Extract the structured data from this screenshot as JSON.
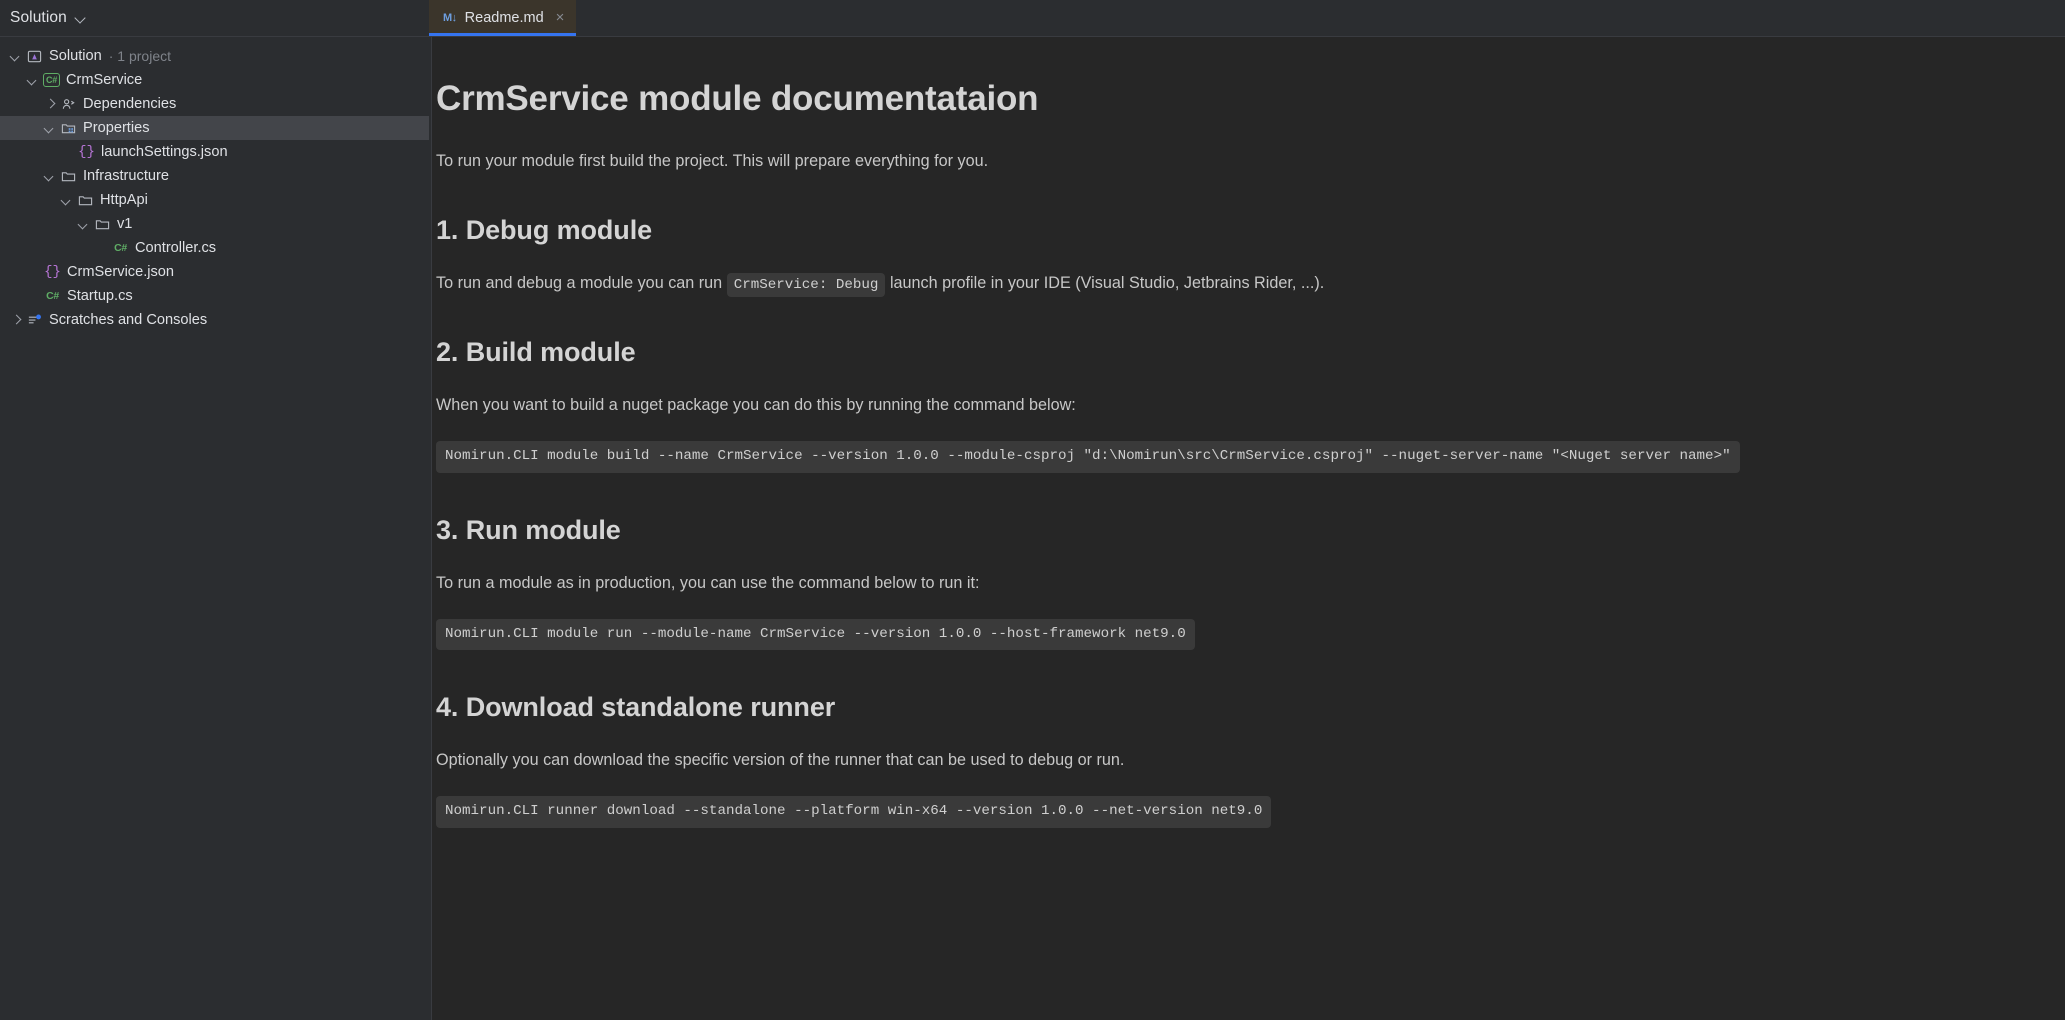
{
  "tool_window": {
    "title": "Solution",
    "chevron_icon": "chevron-down-icon"
  },
  "editor_tabs": [
    {
      "label": "Readme.md",
      "icon": "markdown-icon",
      "icon_glyph": "M↓",
      "close_glyph": "×",
      "active": true,
      "accent_color": "#3574f0",
      "background": "#3b352b"
    }
  ],
  "solution_tree": [
    {
      "label": "Solution",
      "sub": "· 1 project",
      "indent": 0,
      "twisty": "down",
      "icon": "solution-icon",
      "selected": false
    },
    {
      "label": "CrmService",
      "sub": "",
      "indent": 1,
      "twisty": "down",
      "icon": "csharp-project-icon",
      "selected": false
    },
    {
      "label": "Dependencies",
      "sub": "",
      "indent": 2,
      "twisty": "right",
      "icon": "dependencies-icon",
      "selected": false
    },
    {
      "label": "Properties",
      "sub": "",
      "indent": 2,
      "twisty": "down",
      "icon": "properties-folder-icon",
      "selected": true
    },
    {
      "label": "launchSettings.json",
      "sub": "",
      "indent": 3,
      "twisty": "none",
      "icon": "json-file-icon",
      "selected": false
    },
    {
      "label": "Infrastructure",
      "sub": "",
      "indent": 2,
      "twisty": "down",
      "icon": "folder-icon",
      "selected": false
    },
    {
      "label": "HttpApi",
      "sub": "",
      "indent": 3,
      "twisty": "down",
      "icon": "folder-icon",
      "selected": false
    },
    {
      "label": "v1",
      "sub": "",
      "indent": 4,
      "twisty": "down",
      "icon": "folder-icon",
      "selected": false
    },
    {
      "label": "Controller.cs",
      "sub": "",
      "indent": 5,
      "twisty": "none",
      "icon": "csharp-file-icon",
      "selected": false
    },
    {
      "label": "CrmService.json",
      "sub": "",
      "indent": 2,
      "twisty": "none",
      "icon": "json-file-icon",
      "selected": false
    },
    {
      "label": "Startup.cs",
      "sub": "",
      "indent": 2,
      "twisty": "none",
      "icon": "csharp-file-icon",
      "selected": false
    },
    {
      "label": "Scratches and Consoles",
      "sub": "",
      "indent": 0,
      "twisty": "right",
      "icon": "scratches-icon",
      "selected": false
    }
  ],
  "document": {
    "title": "CrmService module documentataion",
    "intro": "To run your module first build the project. This will prepare everything for you.",
    "sections": [
      {
        "heading": "1. Debug module",
        "paragraph_before": "To run and debug a module you can run",
        "inline_code": "CrmService: Debug",
        "paragraph_after": "launch profile in your IDE (Visual Studio, Jetbrains Rider, ...)."
      },
      {
        "heading": "2. Build module",
        "paragraph": "When you want to build a nuget package you can do this by running the command below:",
        "code_block": "Nomirun.CLI module build --name CrmService --version 1.0.0 --module-csproj \"d:\\Nomirun\\src\\CrmService.csproj\" --nuget-server-name \"<Nuget server name>\""
      },
      {
        "heading": "3. Run module",
        "paragraph": "To run a module as in production, you can use the command below to run it:",
        "code_block": "Nomirun.CLI module run --module-name CrmService --version 1.0.0 --host-framework net9.0"
      },
      {
        "heading": "4. Download standalone runner",
        "paragraph": "Optionally you can download the specific version of the runner that can be used to debug or run.",
        "code_block": "Nomirun.CLI runner download --standalone --platform win-x64 --version 1.0.0 --net-version net9.0"
      }
    ]
  }
}
